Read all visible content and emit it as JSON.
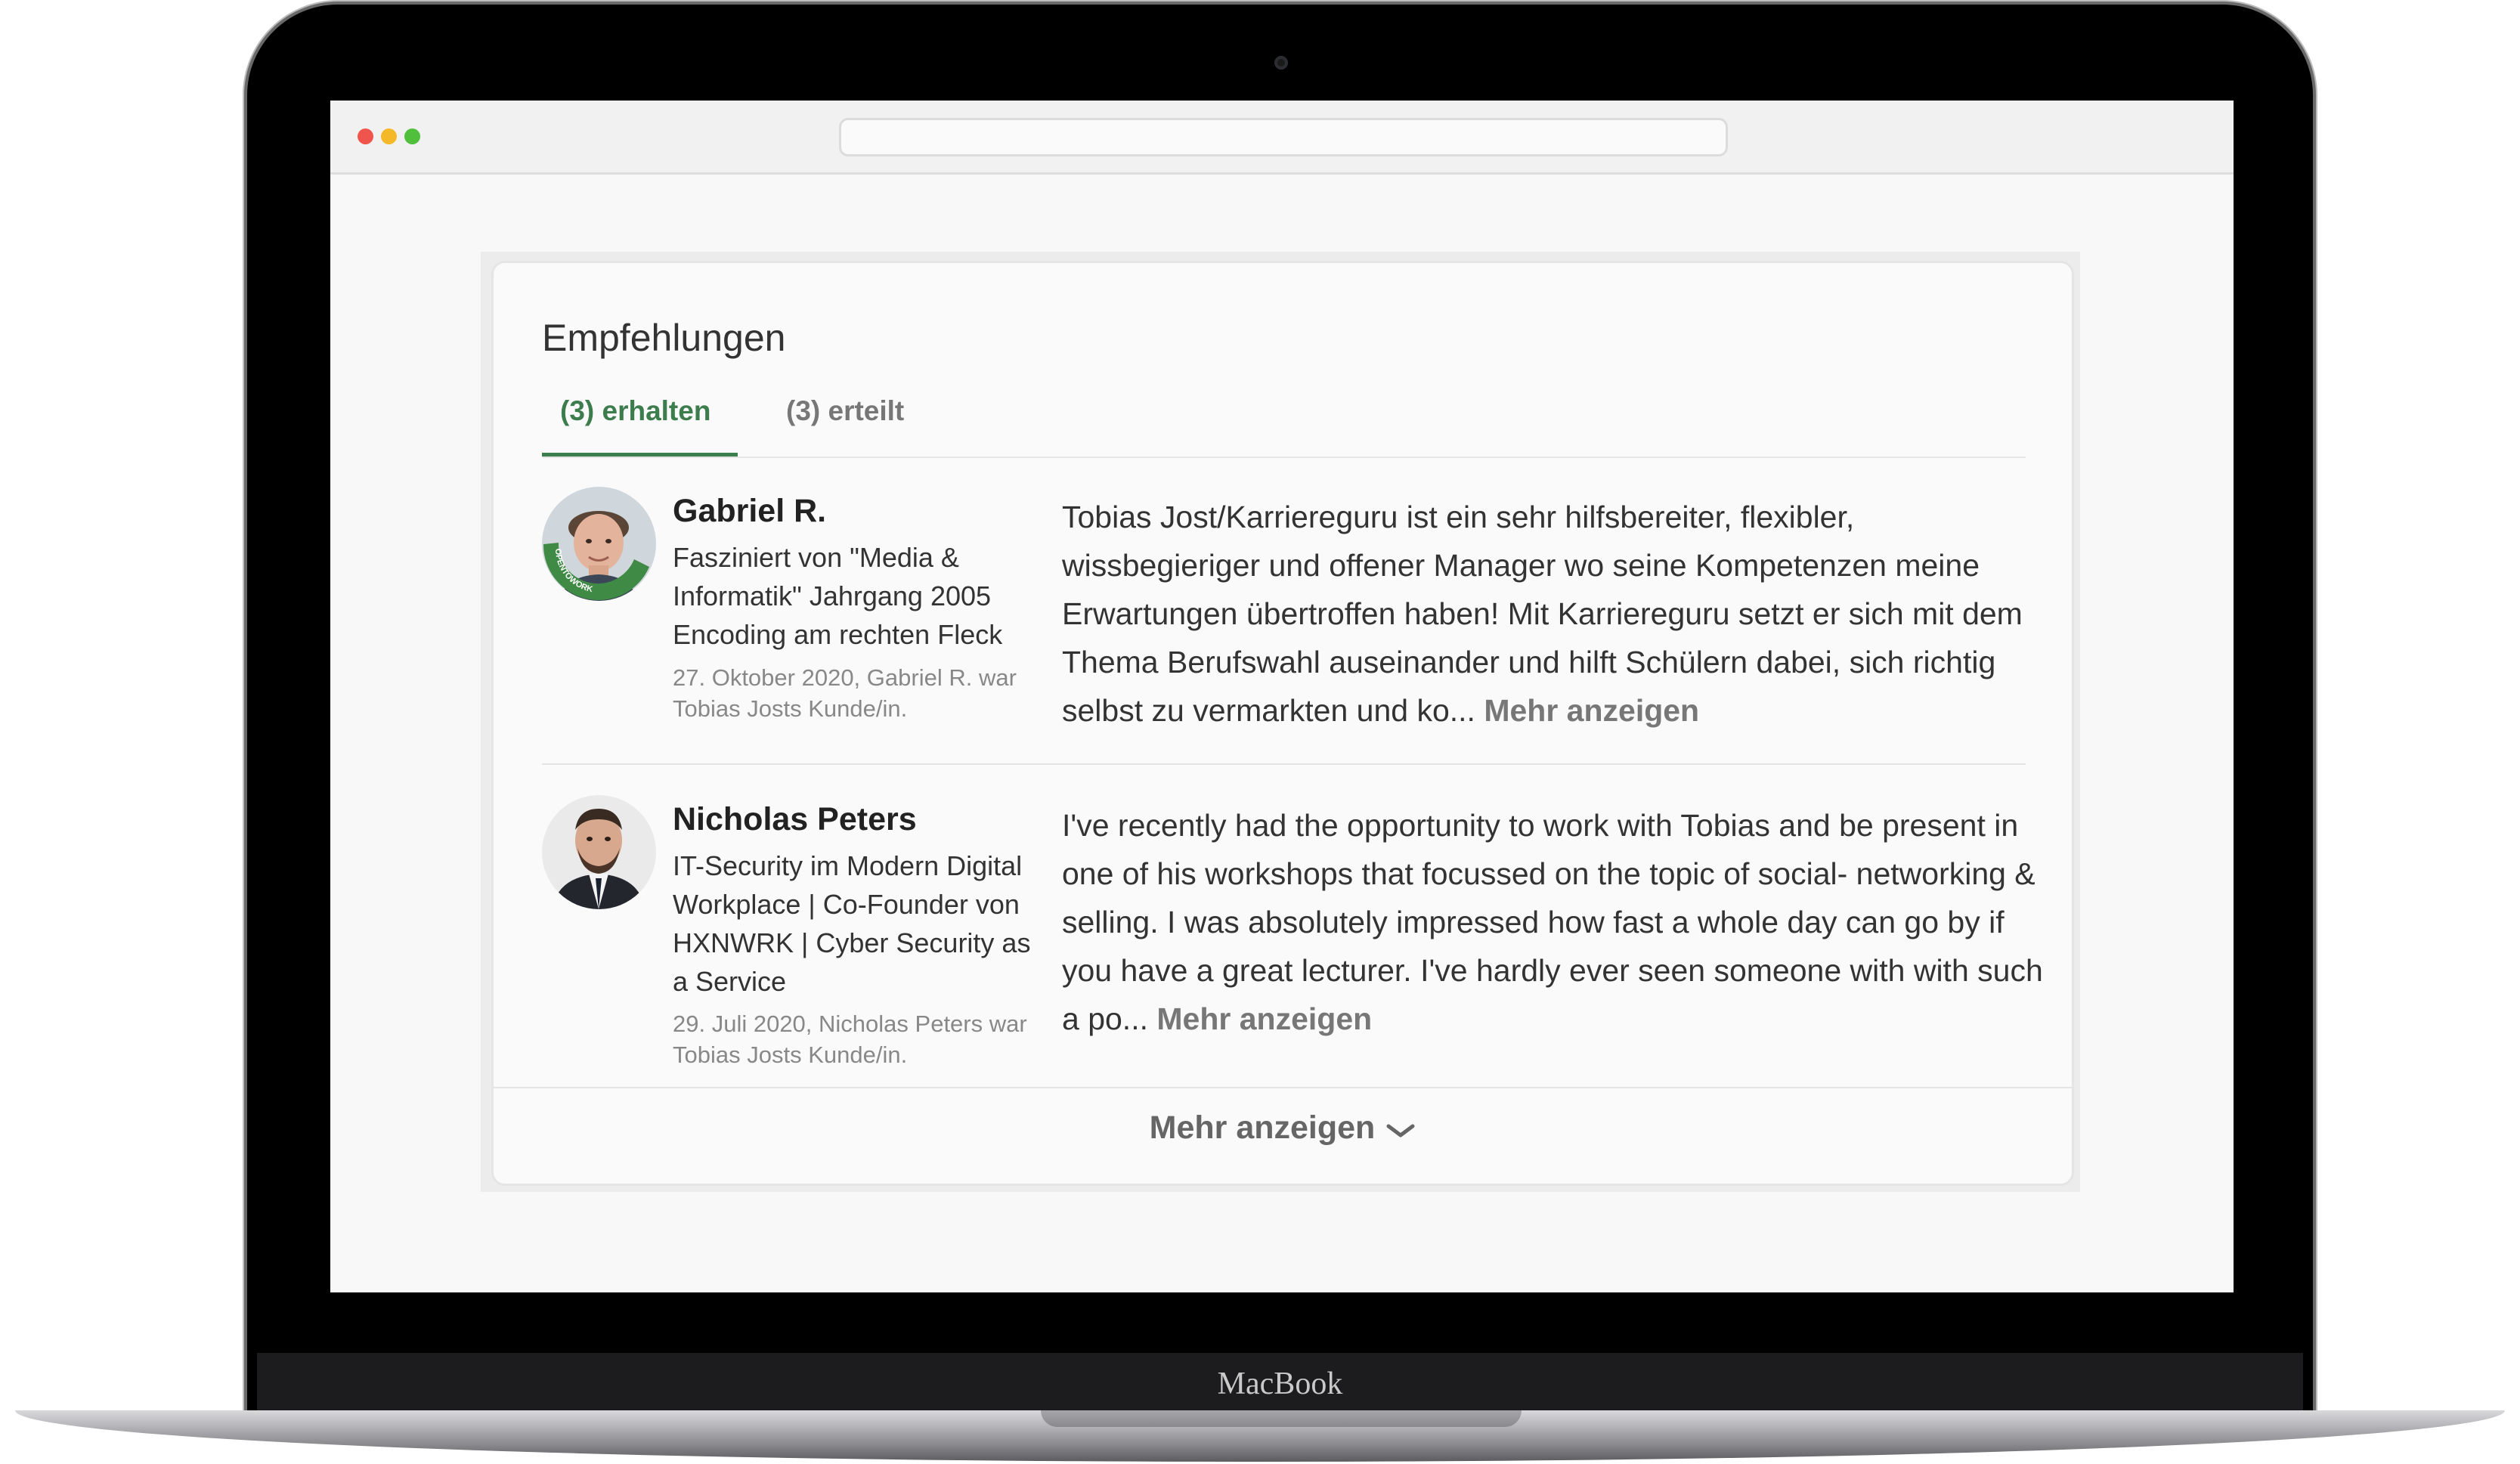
{
  "device": {
    "brand_label": "MacBook"
  },
  "browser": {
    "url": ""
  },
  "section": {
    "title": "Empfehlungen",
    "tabs": [
      {
        "label": "(3) erhalten",
        "active": true
      },
      {
        "label": "(3) erteilt",
        "active": false
      }
    ],
    "accent_color": "#3d7d4d"
  },
  "recommendations": [
    {
      "name": "Gabriel R.",
      "headline": "Fasziniert von \"Media & Informatik\" Jahrgang 2005 Encoding am rechten Fleck",
      "meta": "27. Oktober 2020, Gabriel R. war Tobias Josts Kunde/in.",
      "text": "Tobias Jost/Karriereguru ist ein sehr hilfsbereiter, flexibler, wissbegieriger und offener Manager wo seine Kompetenzen meine Erwartungen übertroffen haben! Mit Karriereguru setzt er sich mit dem Thema Berufswahl auseinander und hilft Schülern dabei, sich richtig selbst zu vermarkten und ko...",
      "more_label": "Mehr anzeigen",
      "avatar_badge": "OPENTOWORK"
    },
    {
      "name": "Nicholas Peters",
      "headline": "IT-Security im Modern Digital Workplace | Co-Founder von HXNWRK | Cyber Security as a Service",
      "meta": "29. Juli 2020, Nicholas Peters war Tobias Josts Kunde/in.",
      "text": "I've recently had the opportunity to work with Tobias and be present in one of his workshops that focussed on the topic of social- networking & selling. I was absolutely impressed how fast a whole day can go by if you have a great lecturer. I've hardly ever seen someone with with such a po...",
      "more_label": "Mehr anzeigen"
    }
  ],
  "footer": {
    "more_label": "Mehr anzeigen",
    "icon": "chevron-down-icon"
  }
}
